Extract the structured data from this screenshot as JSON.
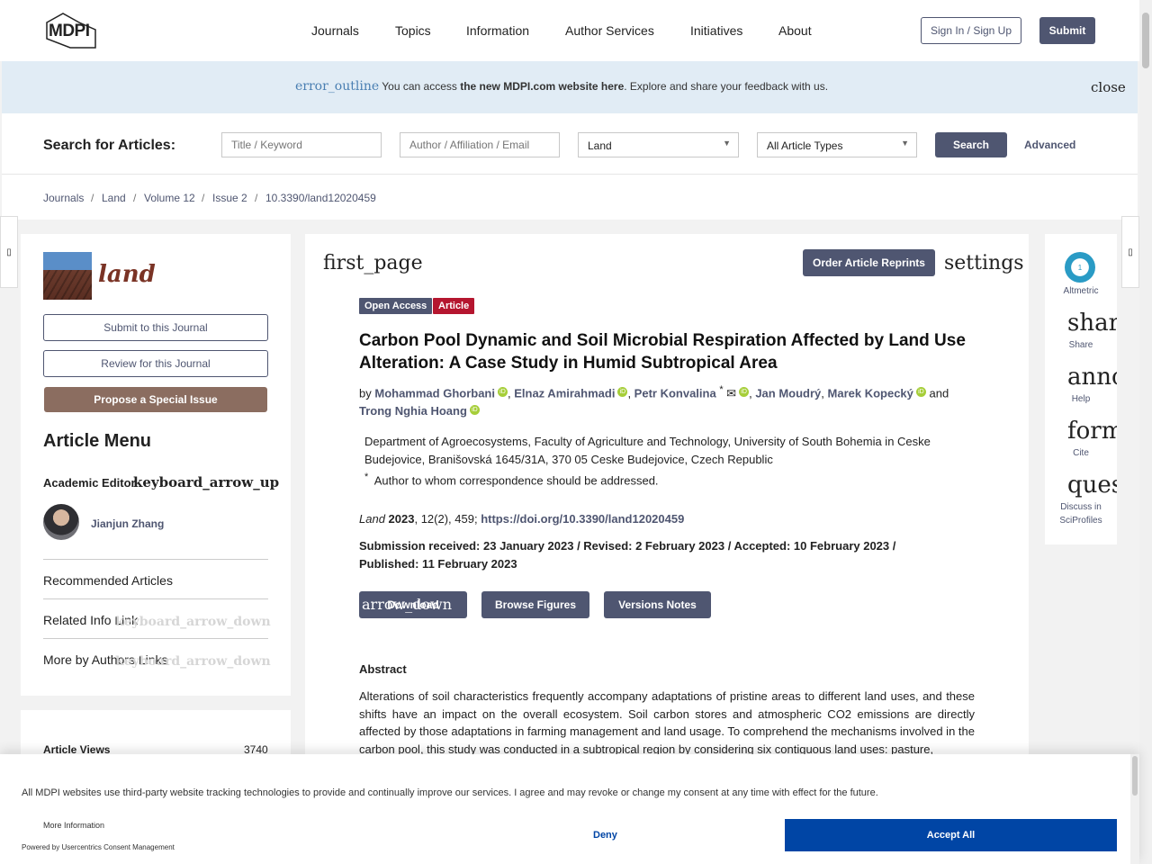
{
  "header": {
    "logo": "MDPI",
    "nav": [
      "Journals",
      "Topics",
      "Information",
      "Author Services",
      "Initiatives",
      "About"
    ],
    "sign_in": "Sign In / Sign Up",
    "submit": "Submit"
  },
  "banner": {
    "icon": "error_outline",
    "text_before": "You can access ",
    "link": "the new MDPI.com website here",
    "text_after": ". Explore and share your feedback with us.",
    "close": "close"
  },
  "search": {
    "label": "Search for Articles:",
    "title_placeholder": "Title / Keyword",
    "author_placeholder": "Author / Affiliation / Email",
    "journal_value": "Land",
    "type_value": "All Article Types",
    "search_button": "Search",
    "advanced": "Advanced"
  },
  "breadcrumb": {
    "items": [
      "Journals",
      "Land",
      "Volume 12",
      "Issue 2",
      "10.3390/land12020459"
    ],
    "sep": "/"
  },
  "left": {
    "journal_name": "land",
    "submit_journal": "Submit to this Journal",
    "review_journal": "Review for this Journal",
    "propose": "Propose a Special Issue",
    "menu_title": "Article Menu",
    "academic_editor": "Academic Editor",
    "arrow_up": "keyboard_arrow_up",
    "editor_name": "Jianjun Zhang",
    "recommended": "Recommended Articles",
    "related": "Related Info Link",
    "more_authors": "More by Authors Links",
    "arrow_down": "keyboard_arrow_down",
    "views_label": "Article Views",
    "views_value": "3740"
  },
  "article": {
    "first_page_icon": "first_page",
    "order_reprints": "Order Article Reprints",
    "settings_icon": "settings",
    "badge_open": "Open Access",
    "badge_type": "Article",
    "title": "Carbon Pool Dynamic and Soil Microbial Respiration Affected by Land Use Alteration: A Case Study in Humid Subtropical Area",
    "by": "by",
    "authors": [
      "Mohammad Ghorbani",
      "Elnaz Amirahmadi",
      "Petr Konvalina",
      "Jan Moudrý",
      "Marek Kopecký",
      "Trong Nghia Hoang"
    ],
    "corr_mark": "*",
    "and": "and",
    "orcid_label": "iD",
    "affiliation": "Department of Agroecosystems, Faculty of Agriculture and Technology, University of South Bohemia in Ceske Budejovice, Branišovská 1645/31A, 370 05 Ceske Budejovice, Czech Republic",
    "correspondence": "Author to whom correspondence should be addressed.",
    "cite_journal": "Land",
    "cite_year": "2023",
    "cite_rest": ", 12(2), 459; ",
    "doi": "https://doi.org/10.3390/land12020459",
    "dates": "Submission received: 23 January 2023 / Revised: 2 February 2023 / Accepted: 10 February 2023 / Published: 11 February 2023",
    "download": "Download",
    "download_icon": "arrow_down",
    "browse_figures": "Browse Figures",
    "versions_notes": "Versions Notes",
    "abstract_heading": "Abstract",
    "abstract_text": "Alterations of soil characteristics frequently accompany adaptations of pristine areas to different land uses, and these shifts have an impact on the overall ecosystem. Soil carbon stores and atmospheric CO2 emissions are directly affected by those adaptations in farming management and land usage. To comprehend the mechanisms involved in the carbon pool, this study was conducted in a subtropical region by considering six contiguous land uses: pasture,"
  },
  "right": {
    "altmetric_value": "1",
    "altmetric_label": "Altmetric",
    "share_icon": "share",
    "share_label": "Share",
    "help_icon": "announcement",
    "help_label": "Help",
    "cite_icon": "format_quote",
    "cite_label": "Cite",
    "discuss_icon": "question_answer",
    "discuss_label": "Discuss in SciProfiles"
  },
  "consent": {
    "text": "All MDPI websites use third-party website tracking technologies to provide and continually improve our services. I agree and may revoke or change my consent at any time with effect for the future.",
    "more_info": "More Information",
    "powered": "Powered by Usercentrics Consent Management",
    "deny": "Deny",
    "accept": "Accept All"
  },
  "colors": {
    "brand": "#4f5671",
    "banner": "#e1ecf5",
    "accept": "#0045a5",
    "article_badge": "#b5162f",
    "propose": "#8b6d60"
  }
}
